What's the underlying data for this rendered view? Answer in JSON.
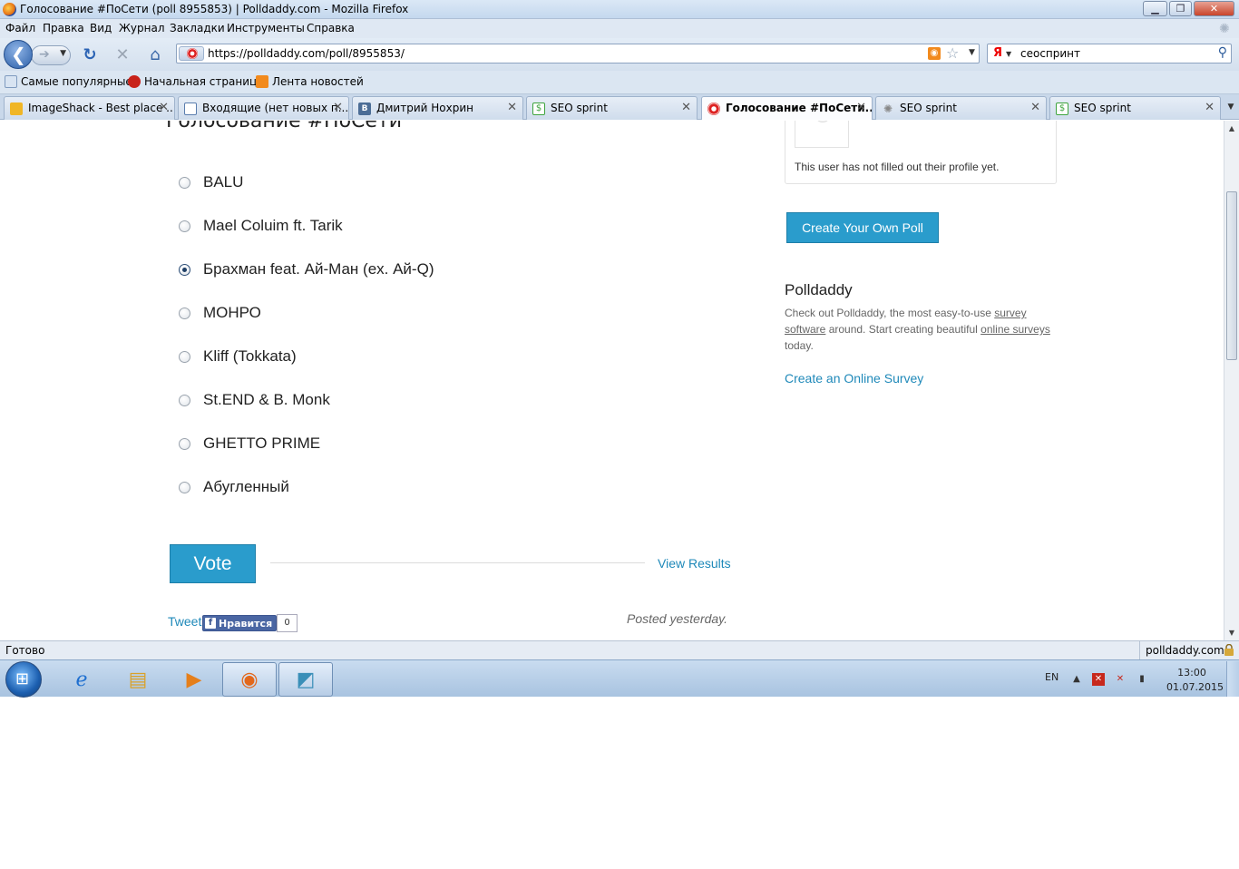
{
  "window": {
    "title": "Голосование #ПоСети (poll 8955853) | Polldaddy.com - Mozilla Firefox"
  },
  "menu": [
    "Файл",
    "Правка",
    "Вид",
    "Журнал",
    "Закладки",
    "Инструменты",
    "Справка"
  ],
  "nav": {
    "url": "https://polldaddy.com/poll/8955853/",
    "search_engine": "Я",
    "search_query": "сеоспринт"
  },
  "bookmarks": [
    "Самые популярные",
    "Начальная страница",
    "Лента новостей"
  ],
  "tabs": [
    {
      "label": "ImageShack - Best place ...",
      "active": false
    },
    {
      "label": "Входящие (нет новых п...",
      "active": false
    },
    {
      "label": "Дмитрий Нохрин",
      "active": false
    },
    {
      "label": "SEO sprint",
      "active": false
    },
    {
      "label": "Голосование #ПоСети...",
      "active": true
    },
    {
      "label": "SEO sprint",
      "active": false
    },
    {
      "label": "SEO sprint",
      "active": false
    }
  ],
  "poll": {
    "title": "Голосование #ПоСети",
    "options": [
      {
        "label": "BALU",
        "checked": false
      },
      {
        "label": "Mael Coluim ft. Tarik",
        "checked": false
      },
      {
        "label": "Брахман feat. Ай-Ман (ex. Ай-Q)",
        "checked": true
      },
      {
        "label": "МОНРО",
        "checked": false
      },
      {
        "label": "Kliff (Tokkata)",
        "checked": false
      },
      {
        "label": "St.END & B. Monk",
        "checked": false
      },
      {
        "label": "GHETTO PRIME",
        "checked": false
      },
      {
        "label": "Абугленный",
        "checked": false
      }
    ],
    "vote_label": "Vote",
    "view_results_label": "View Results",
    "tweet_label": "Tweet",
    "like_label": "Нравится",
    "like_count": "0",
    "posted": "Posted yesterday."
  },
  "sidebar": {
    "profile_text": "This user has not filled out their profile yet.",
    "create_poll_label": "Create Your Own Poll",
    "heading": "Polldaddy",
    "desc_1": "Check out Polldaddy, the most easy-to-use ",
    "desc_link_1": "survey software",
    "desc_2": " around. Start creating beautiful ",
    "desc_link_2": "online surveys",
    "desc_3": " today.",
    "online_survey_label": "Create an Online Survey"
  },
  "status": {
    "text": "Готово",
    "domain": "polldaddy.com"
  },
  "taskbar": {
    "lang": "EN",
    "time": "13:00",
    "date": "01.07.2015"
  },
  "colors": {
    "accent": "#2a9ccc",
    "link": "#1f89b9"
  }
}
